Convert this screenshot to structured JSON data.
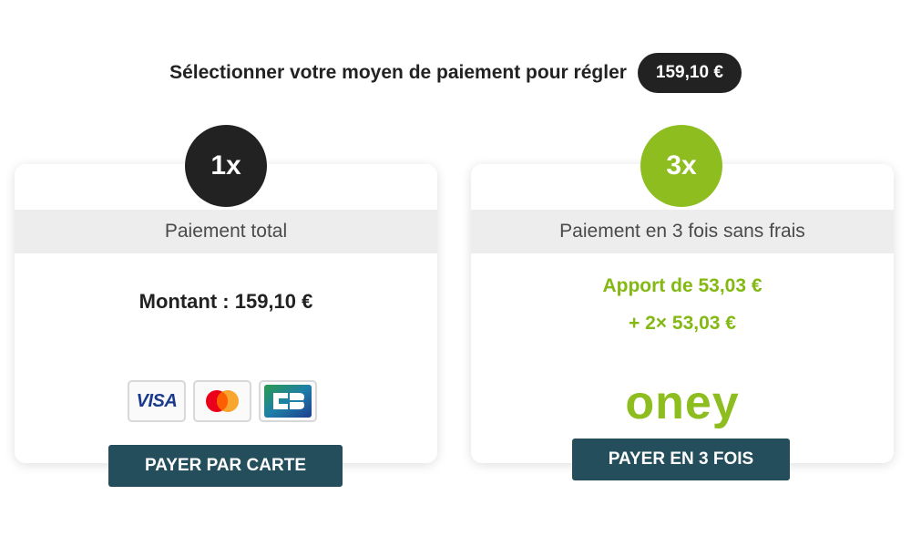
{
  "header": {
    "text": "Sélectionner votre moyen de paiement pour régler",
    "amount": "159,10 €"
  },
  "option_single": {
    "badge": "1x",
    "title": "Paiement total",
    "amount_text": "Montant : 159,10 €",
    "logos": [
      {
        "name": "visa-logo",
        "text": "VISA"
      },
      {
        "name": "mastercard-logo"
      },
      {
        "name": "cb-logo",
        "text": "CB"
      }
    ],
    "button_label": "PAYER PAR CARTE"
  },
  "option_split": {
    "badge": "3x",
    "title": "Paiement en 3 fois sans frais",
    "line1": "Apport de 53,03 €",
    "line2": "+ 2× 53,03 €",
    "brand": "oney",
    "button_label": "PAYER EN 3 FOIS"
  },
  "colors": {
    "dark": "#222222",
    "green": "#8dbd1f",
    "button": "#254e5c",
    "band": "#ededed"
  }
}
